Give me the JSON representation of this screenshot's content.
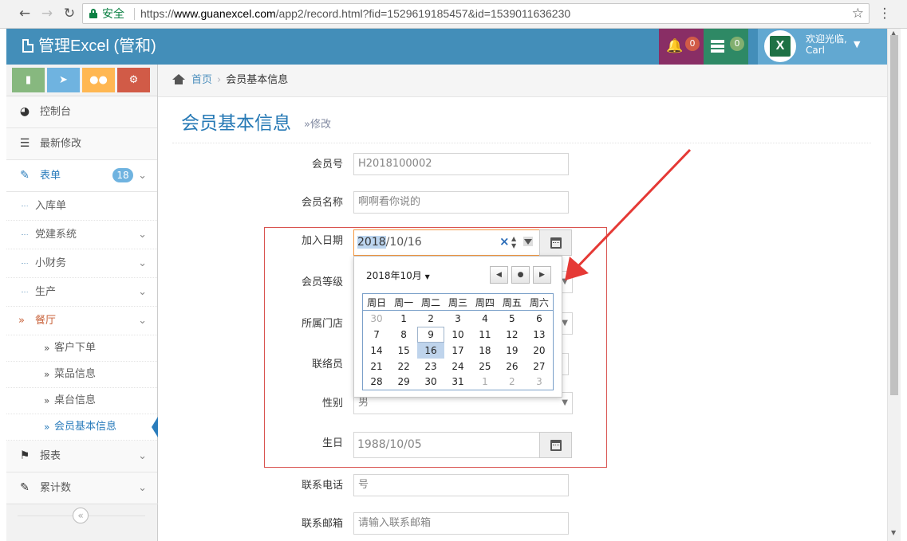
{
  "browser": {
    "secure_label": "安全",
    "url_scheme": "https://",
    "url_host": "www.guanexcel.com",
    "url_path": "/app2/record.html?fid=1529619185457&id=1539011636230"
  },
  "header": {
    "brand": "管理Excel (管和)",
    "notifications_count": "0",
    "tasks_count": "0",
    "welcome": "欢迎光临,",
    "user_name": "Carl",
    "avatar_letter": "X"
  },
  "sidebar": {
    "items": [
      {
        "label": "控制台",
        "icon": "dashboard-icon"
      },
      {
        "label": "最新修改",
        "icon": "list-icon"
      },
      {
        "label": "表单",
        "icon": "edit-icon",
        "badge": "18"
      }
    ],
    "form_sub": [
      {
        "label": "入库单"
      },
      {
        "label": "党建系统"
      },
      {
        "label": "小财务"
      },
      {
        "label": "生产"
      },
      {
        "label": "餐厅"
      }
    ],
    "restaurant_sub": [
      {
        "label": "客户下单"
      },
      {
        "label": "菜品信息"
      },
      {
        "label": "桌台信息"
      },
      {
        "label": "会员基本信息"
      }
    ],
    "bottom_items": [
      {
        "label": "报表",
        "icon": "tag-icon"
      },
      {
        "label": "累计数",
        "icon": "edit-icon"
      }
    ],
    "collapse_symbol": "«"
  },
  "breadcrumb": {
    "home": "首页",
    "current": "会员基本信息"
  },
  "page": {
    "title": "会员基本信息",
    "subtitle": "»修改"
  },
  "form": {
    "member_no": {
      "label": "会员号",
      "value": "H2018100002"
    },
    "member_name": {
      "label": "会员名称",
      "value": "啊啊看你说的"
    },
    "join_date": {
      "label": "加入日期",
      "year": "2018",
      "rest": "/10/16"
    },
    "member_level": {
      "label": "会员等级"
    },
    "store": {
      "label": "所属门店"
    },
    "contact": {
      "label": "联络员"
    },
    "gender": {
      "label": "性别",
      "value": "男"
    },
    "birthday": {
      "label": "生日",
      "value": "1988/10/05"
    },
    "phone": {
      "label": "联系电话",
      "value": "号"
    },
    "email": {
      "label": "联系邮箱",
      "placeholder": "请输入联系邮箱"
    }
  },
  "datepicker": {
    "month_label": "2018年10月",
    "weekdays": [
      "周日",
      "周一",
      "周二",
      "周三",
      "周四",
      "周五",
      "周六"
    ],
    "weeks": [
      [
        "30",
        "1",
        "2",
        "3",
        "4",
        "5",
        "6"
      ],
      [
        "7",
        "8",
        "9",
        "10",
        "11",
        "12",
        "13"
      ],
      [
        "14",
        "15",
        "16",
        "17",
        "18",
        "19",
        "20"
      ],
      [
        "21",
        "22",
        "23",
        "24",
        "25",
        "26",
        "27"
      ],
      [
        "28",
        "29",
        "30",
        "31",
        "1",
        "2",
        "3"
      ]
    ],
    "selected": "16",
    "today": "9"
  },
  "colors": {
    "accent": "#438eb9",
    "highlight_box": "#d9534f",
    "annotation_arrow": "#e53935"
  }
}
